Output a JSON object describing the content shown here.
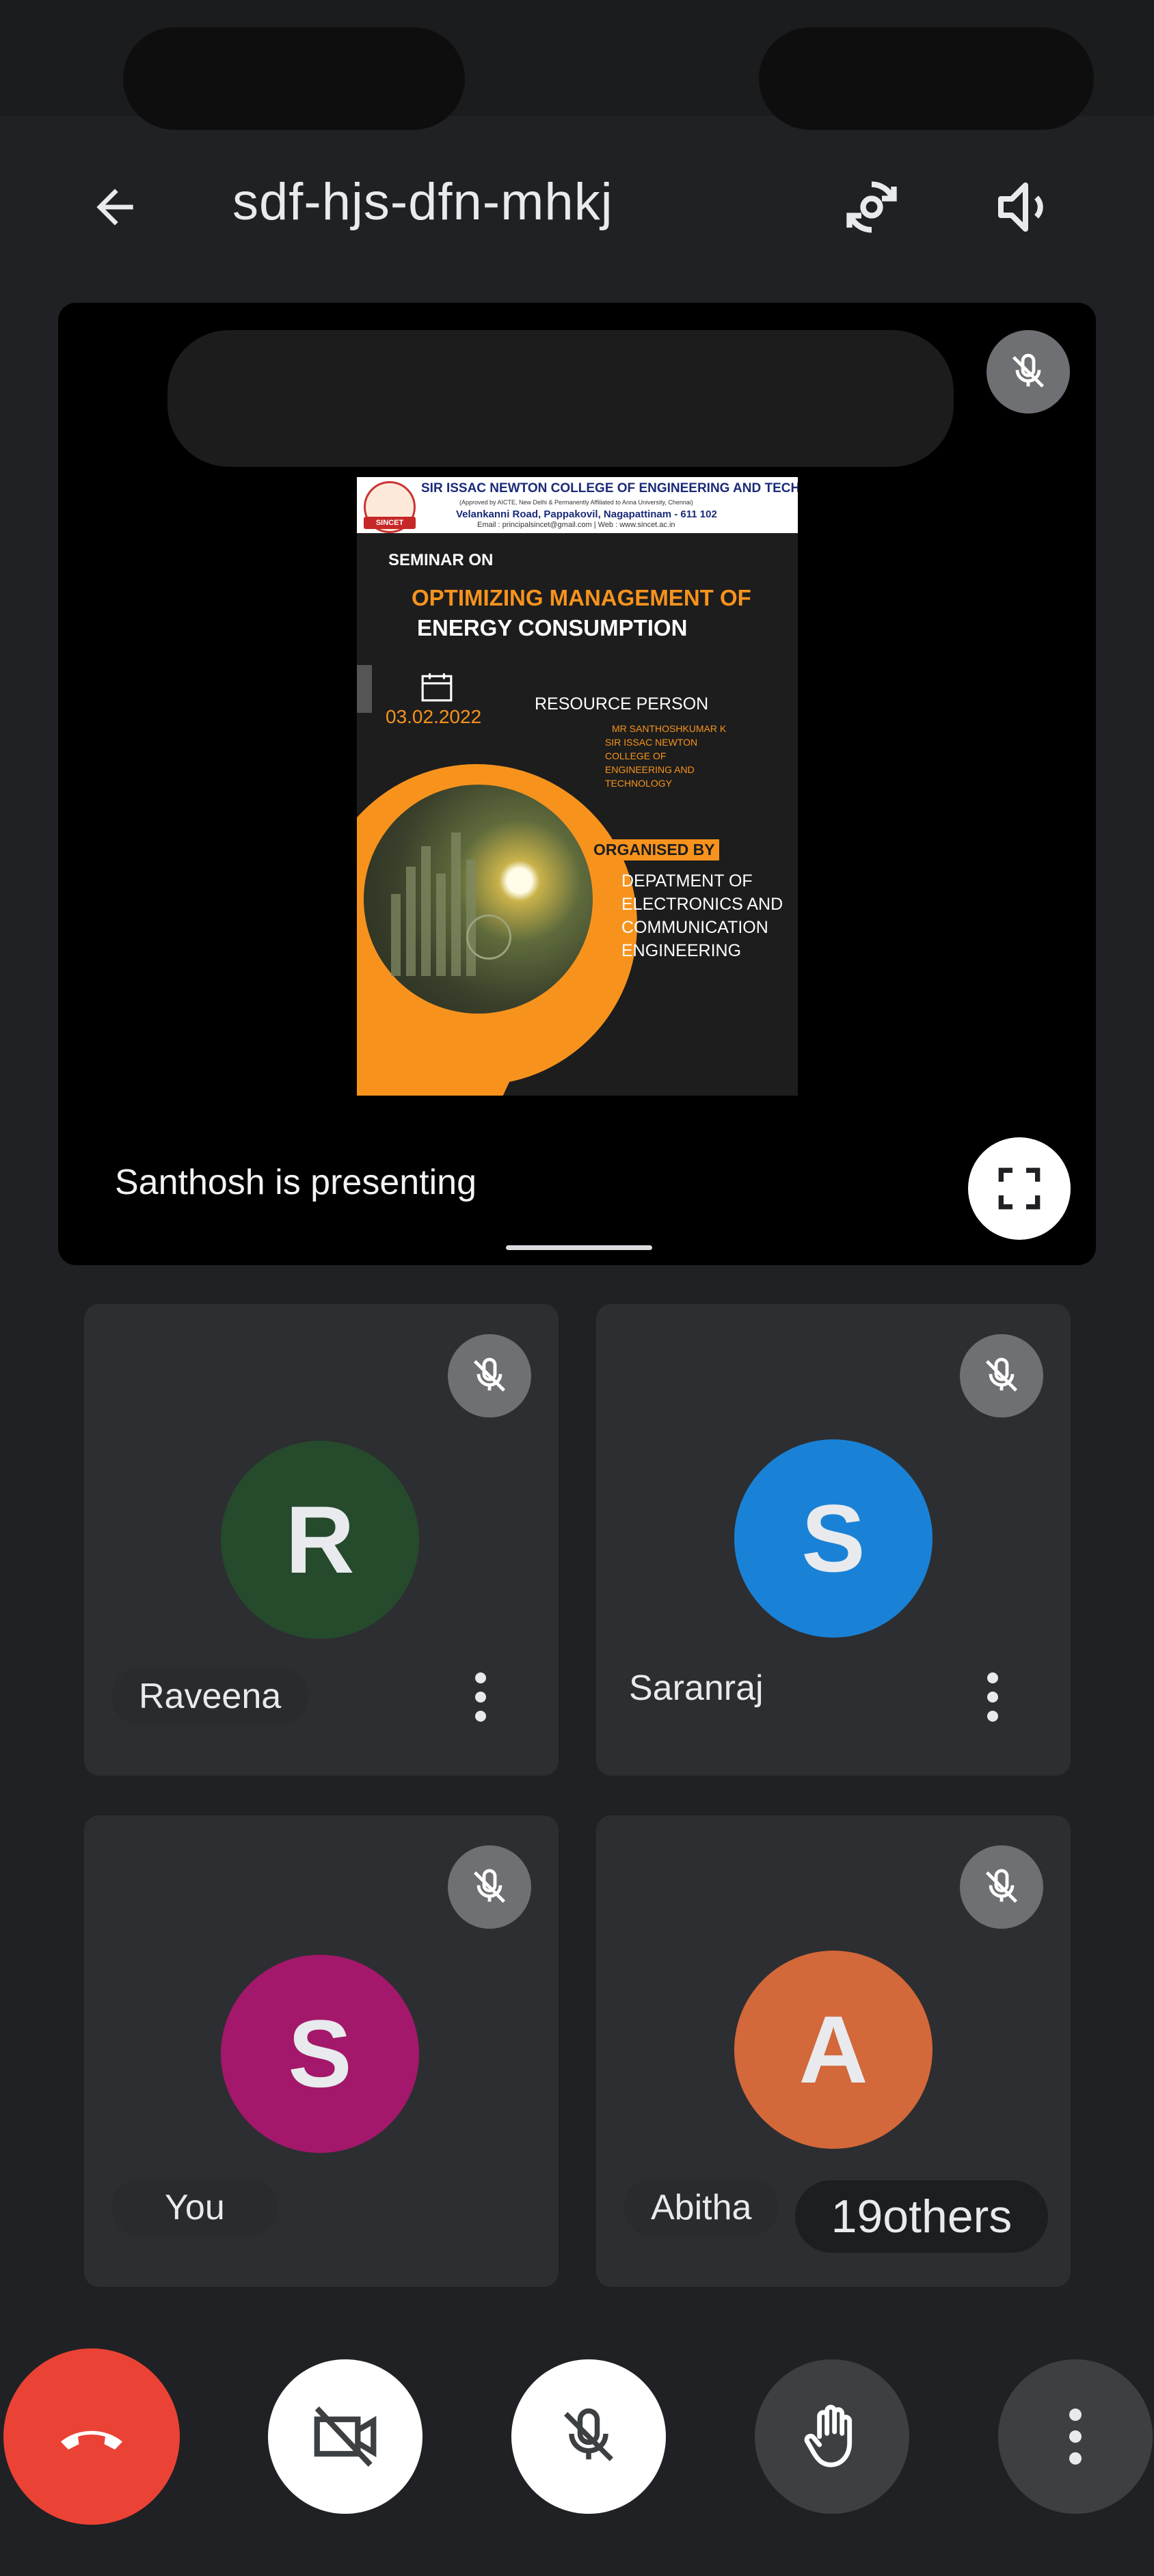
{
  "meeting": {
    "code": "sdf-hjs-dfn-mhkj"
  },
  "topbar": {
    "icons": [
      "back-arrow-icon",
      "switch-camera-icon",
      "speaker-icon"
    ]
  },
  "presentation": {
    "presenting_text": "Santhosh is presenting",
    "slide": {
      "college_name": "SIR ISSAC NEWTON COLLEGE OF ENGINEERING AND TECHNOLOGY",
      "approval_line": "(Approved by AICTE, New Delhi & Permanently Affiliated to Anna University, Chennai)",
      "address": "Velankanni Road, Pappakovil, Nagapattinam - 611 102",
      "contact": "Email : principalsincet@gmail.com | Web : www.sincet.ac.in",
      "logo_text": "SINCET",
      "seminar_label": "SEMINAR ON",
      "title_line1": "OPTIMIZING MANAGEMENT OF",
      "title_line2": "ENERGY CONSUMPTION",
      "date": "03.02.2022",
      "resource_label": "RESOURCE PERSON",
      "resource_name": "MR SANTHOSHKUMAR K",
      "resource_org_1": "SIR ISSAC NEWTON",
      "resource_org_2": "COLLEGE OF",
      "resource_org_3": "ENGINEERING AND",
      "resource_org_4": "TECHNOLOGY",
      "organised_label": "ORGANISED BY",
      "dept_1": "DEPATMENT OF",
      "dept_2": "ELECTRONICS AND",
      "dept_3": "COMMUNICATION",
      "dept_4": "ENGINEERING"
    }
  },
  "participants": [
    {
      "initial": "R",
      "name": "Raveena",
      "color": "#254a2c"
    },
    {
      "initial": "S",
      "name": "Saranraj",
      "color": "#1a82d6"
    },
    {
      "initial": "S",
      "name": "You",
      "color": "#a3186a"
    },
    {
      "initial": "A",
      "name": "Abitha",
      "color": "#d3683a"
    }
  ],
  "others_count": "19others",
  "controls": {
    "icons": [
      "end-call-icon",
      "camera-off-icon",
      "mic-off-icon",
      "raise-hand-icon",
      "more-options-icon"
    ],
    "end_call_color": "#ea4335"
  }
}
